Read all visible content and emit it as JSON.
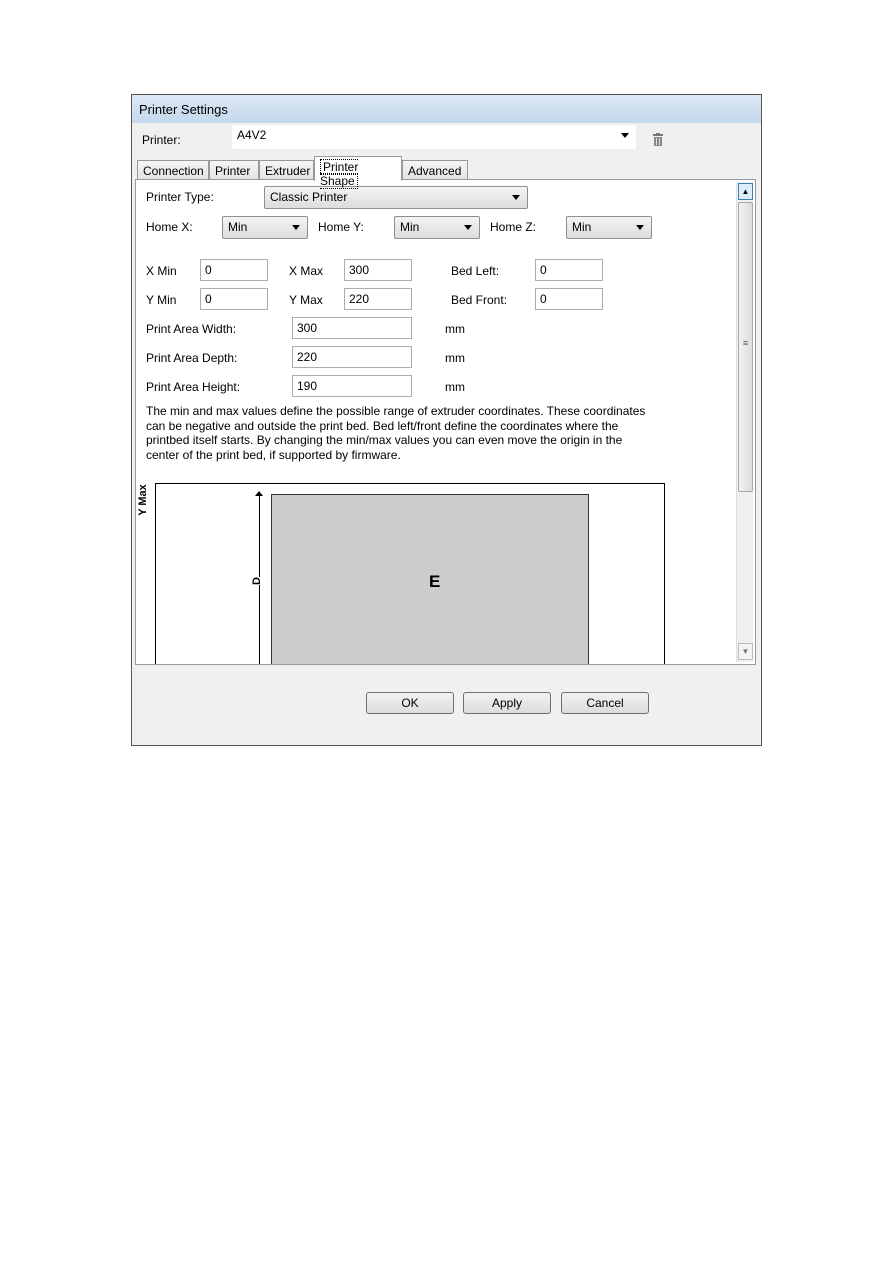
{
  "window": {
    "title": "Printer Settings"
  },
  "printer": {
    "label": "Printer:",
    "value": "A4V2"
  },
  "tabs": [
    {
      "label": "Connection"
    },
    {
      "label": "Printer"
    },
    {
      "label": "Extruder"
    },
    {
      "label": "Printer Shape",
      "active": true
    },
    {
      "label": "Advanced"
    }
  ],
  "shape": {
    "printer_type_label": "Printer Type:",
    "printer_type": "Classic Printer",
    "home_x_label": "Home X:",
    "home_x": "Min",
    "home_y_label": "Home Y:",
    "home_y": "Min",
    "home_z_label": "Home Z:",
    "home_z": "Min",
    "x_min_label": "X Min",
    "x_min": "0",
    "x_max_label": "X Max",
    "x_max": "300",
    "bed_left_label": "Bed Left:",
    "bed_left": "0",
    "y_min_label": "Y Min",
    "y_min": "0",
    "y_max_label": "Y Max",
    "y_max": "220",
    "bed_front_label": "Bed Front:",
    "bed_front": "0",
    "width_label": "Print Area Width:",
    "width": "300",
    "depth_label": "Print Area Depth:",
    "depth": "220",
    "height_label": "Print Area Height:",
    "height": "190",
    "unit": "mm",
    "help": "The min and max values define the possible range of extruder coordinates. These coordinates can be negative and outside the print bed. Bed left/front define the coordinates where the printbed itself starts. By changing the min/max values you can even move the origin in the center of the print bed, if supported by firmware."
  },
  "diagram": {
    "y_max_label": "Y Max",
    "d_label": "D",
    "e_label": "E",
    "bed_color": "#cccccc"
  },
  "buttons": {
    "ok": "OK",
    "apply": "Apply",
    "cancel": "Cancel"
  }
}
